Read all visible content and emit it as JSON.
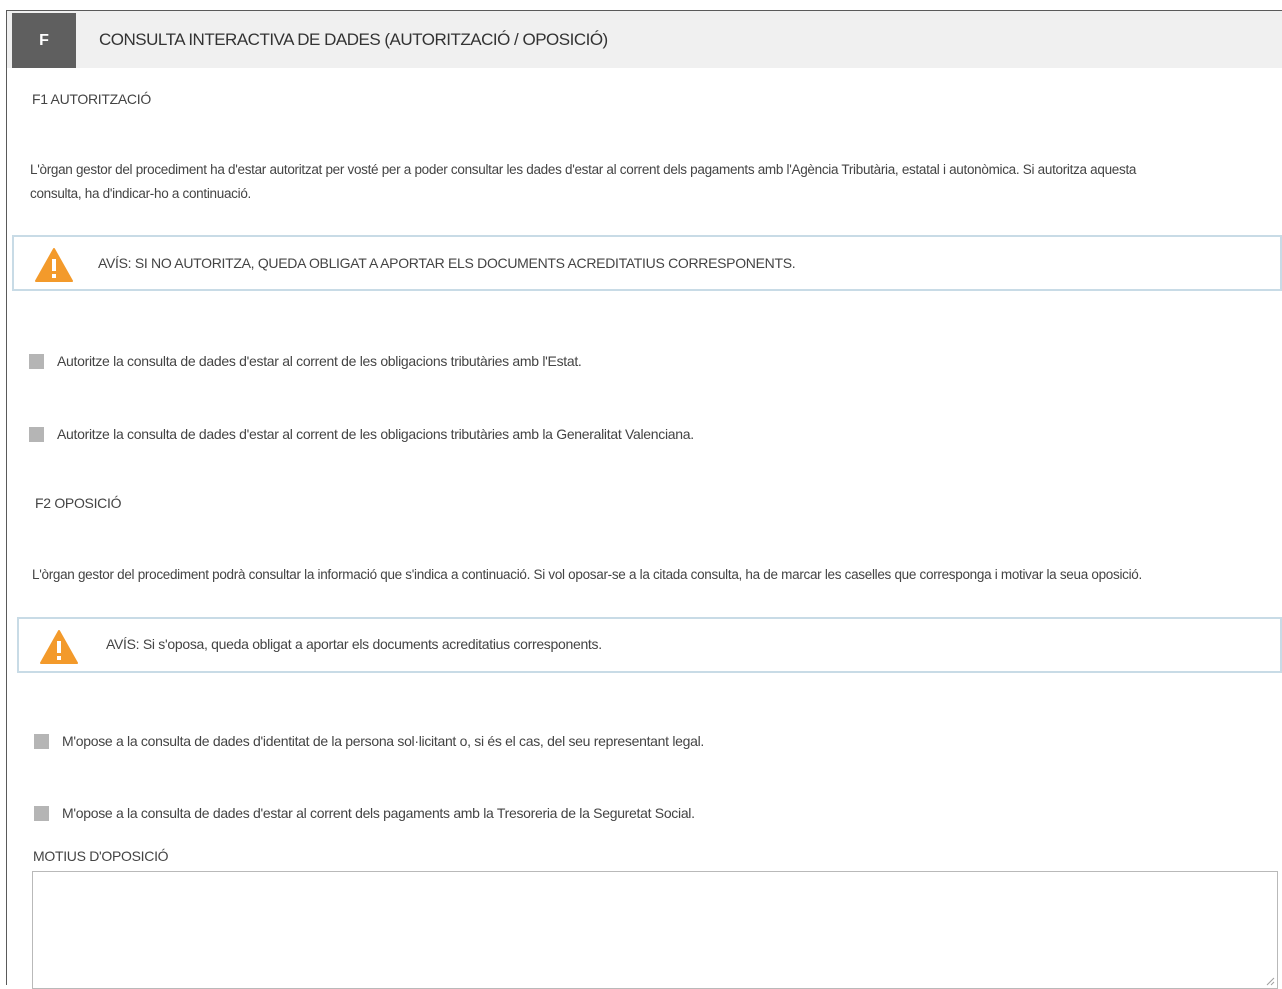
{
  "section": {
    "letter": "F",
    "title": "CONSULTA INTERACTIVA DE DADES (AUTORITZACIÓ / OPOSICIÓ)"
  },
  "f1": {
    "title": "F1 AUTORITZACIÓ",
    "description_line1": "L'òrgan gestor del procediment ha d'estar autoritzat per vosté per a poder consultar les dades d'estar al corrent dels pagaments amb l'Agència Tributària, estatal i autonòmica. Si autoritza aquesta",
    "description_line2": "consulta, ha d'indicar-ho a continuació.",
    "notice": "AVÍS: SI NO AUTORITZA, QUEDA OBLIGAT A APORTAR ELS DOCUMENTS ACREDITATIUS CORRESPONENTS.",
    "checkboxes": [
      {
        "label": "Autoritze la consulta de dades d'estar al corrent de les obligacions tributàries amb l'Estat.",
        "checked": false
      },
      {
        "label": "Autoritze la consulta de dades d'estar al corrent de les obligacions tributàries amb la Generalitat Valenciana.",
        "checked": false
      }
    ]
  },
  "f2": {
    "title": "F2 OPOSICIÓ",
    "description": "L'òrgan gestor del procediment podrà consultar la informació que s'indica a continuació. Si vol oposar-se a la citada consulta, ha de marcar les caselles que corresponga i motivar la seua oposició.",
    "notice": "AVÍS: Si s'oposa, queda obligat a aportar els documents acreditatius corresponents.",
    "checkboxes": [
      {
        "label": "M'opose a la consulta de dades d'identitat de la persona sol·licitant o, si és el cas, del seu representant legal.",
        "checked": false
      },
      {
        "label": "M'opose a la consulta de dades d'estar al corrent dels pagaments amb la Tresoreria de la Seguretat Social.",
        "checked": false
      }
    ],
    "reasons_label": "MOTIUS D'OPOSICIÓ",
    "reasons_value": ""
  },
  "colors": {
    "header_bg": "#f0f0f0",
    "badge_bg": "#5f5f5f",
    "notice_border": "#c8dbe6",
    "warning_orange": "#f39a2b",
    "checkbox_gray": "#b5b5b5"
  },
  "icons": {
    "notice": "warning-triangle-icon"
  }
}
